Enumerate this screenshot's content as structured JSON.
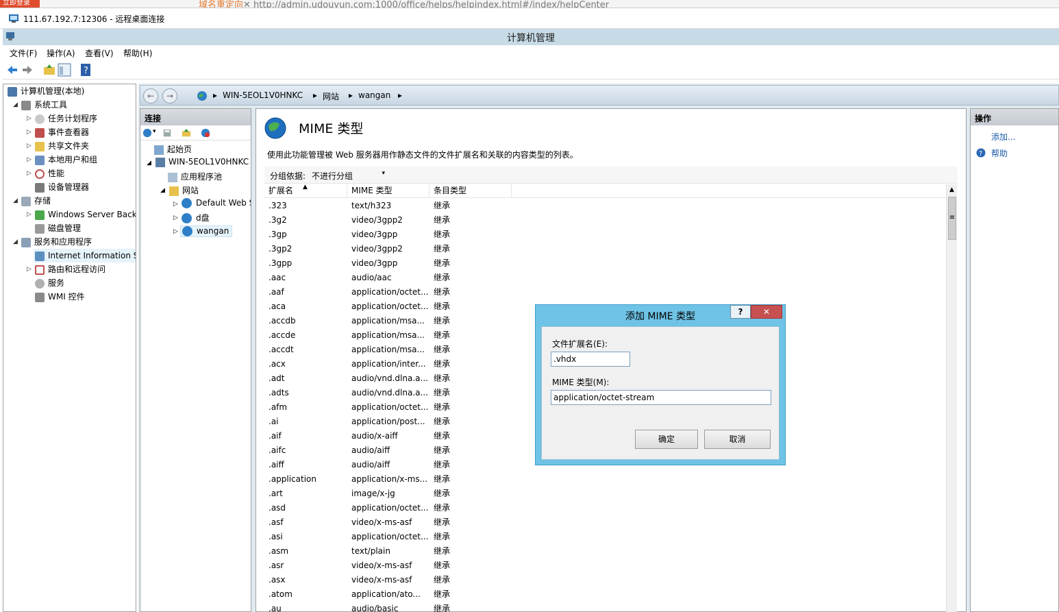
{
  "browser": {
    "badge": "立即登录",
    "redirect_label": "域名重定向",
    "url": "http://admin.udouyun.com:1000/office/helps/helpindex.html#/index/helpCenter"
  },
  "rdp": {
    "title": "111.67.192.7:12306 - 远程桌面连接"
  },
  "mmc": {
    "title": "计算机管理"
  },
  "menu": {
    "file": "文件(F)",
    "action": "操作(A)",
    "view": "查看(V)",
    "help": "帮助(H)"
  },
  "tree": {
    "root": "计算机管理(本地)",
    "system_tools": "系统工具",
    "task_scheduler": "任务计划程序",
    "event_viewer": "事件查看器",
    "shared_folders": "共享文件夹",
    "local_users": "本地用户和组",
    "performance": "性能",
    "device_manager": "设备管理器",
    "storage": "存储",
    "windows_backup": "Windows Server Back",
    "disk_management": "磁盘管理",
    "services_apps": "服务和应用程序",
    "iis": "Internet Information S",
    "routing": "路由和远程访问",
    "services": "服务",
    "wmi": "WMI 控件"
  },
  "breadcrumb": {
    "server": "WIN-5EOL1V0HNKC",
    "sites": "网站",
    "site": "wangan"
  },
  "connections": {
    "header": "连接",
    "start_page": "起始页",
    "server": "WIN-5EOL1V0HNKC",
    "app_pools": "应用程序池",
    "sites": "网站",
    "site1": "Default Web S",
    "site2": "d盘",
    "site3": "wangan"
  },
  "feature": {
    "title": "MIME 类型",
    "description": "使用此功能管理被 Web 服务器用作静态文件的文件扩展名和关联的内容类型的列表。",
    "group_label": "分组依据:",
    "group_value": "不进行分组"
  },
  "columns": {
    "ext": "扩展名",
    "mime": "MIME 类型",
    "entry": "条目类型"
  },
  "rows": [
    {
      "ext": ".323",
      "mime": "text/h323",
      "entry": "继承"
    },
    {
      "ext": ".3g2",
      "mime": "video/3gpp2",
      "entry": "继承"
    },
    {
      "ext": ".3gp",
      "mime": "video/3gpp",
      "entry": "继承"
    },
    {
      "ext": ".3gp2",
      "mime": "video/3gpp2",
      "entry": "继承"
    },
    {
      "ext": ".3gpp",
      "mime": "video/3gpp",
      "entry": "继承"
    },
    {
      "ext": ".aac",
      "mime": "audio/aac",
      "entry": "继承"
    },
    {
      "ext": ".aaf",
      "mime": "application/octet...",
      "entry": "继承"
    },
    {
      "ext": ".aca",
      "mime": "application/octet...",
      "entry": "继承"
    },
    {
      "ext": ".accdb",
      "mime": "application/msa...",
      "entry": "继承"
    },
    {
      "ext": ".accde",
      "mime": "application/msa...",
      "entry": "继承"
    },
    {
      "ext": ".accdt",
      "mime": "application/msa...",
      "entry": "继承"
    },
    {
      "ext": ".acx",
      "mime": "application/inter...",
      "entry": "继承"
    },
    {
      "ext": ".adt",
      "mime": "audio/vnd.dlna.a...",
      "entry": "继承"
    },
    {
      "ext": ".adts",
      "mime": "audio/vnd.dlna.a...",
      "entry": "继承"
    },
    {
      "ext": ".afm",
      "mime": "application/octet...",
      "entry": "继承"
    },
    {
      "ext": ".ai",
      "mime": "application/post...",
      "entry": "继承"
    },
    {
      "ext": ".aif",
      "mime": "audio/x-aiff",
      "entry": "继承"
    },
    {
      "ext": ".aifc",
      "mime": "audio/aiff",
      "entry": "继承"
    },
    {
      "ext": ".aiff",
      "mime": "audio/aiff",
      "entry": "继承"
    },
    {
      "ext": ".application",
      "mime": "application/x-ms...",
      "entry": "继承"
    },
    {
      "ext": ".art",
      "mime": "image/x-jg",
      "entry": "继承"
    },
    {
      "ext": ".asd",
      "mime": "application/octet...",
      "entry": "继承"
    },
    {
      "ext": ".asf",
      "mime": "video/x-ms-asf",
      "entry": "继承"
    },
    {
      "ext": ".asi",
      "mime": "application/octet...",
      "entry": "继承"
    },
    {
      "ext": ".asm",
      "mime": "text/plain",
      "entry": "继承"
    },
    {
      "ext": ".asr",
      "mime": "video/x-ms-asf",
      "entry": "继承"
    },
    {
      "ext": ".asx",
      "mime": "video/x-ms-asf",
      "entry": "继承"
    },
    {
      "ext": ".atom",
      "mime": "application/ato...",
      "entry": "继承"
    },
    {
      "ext": ".au",
      "mime": "audio/basic",
      "entry": "继承"
    }
  ],
  "actions": {
    "header": "操作",
    "add": "添加...",
    "help": "帮助"
  },
  "dialog": {
    "title": "添加 MIME 类型",
    "help_btn": "?",
    "close_btn": "✕",
    "ext_label": "文件扩展名(E):",
    "ext_value": ".vhdx",
    "mime_label": "MIME 类型(M):",
    "mime_value": "application/octet-stream",
    "ok": "确定",
    "cancel": "取消"
  }
}
